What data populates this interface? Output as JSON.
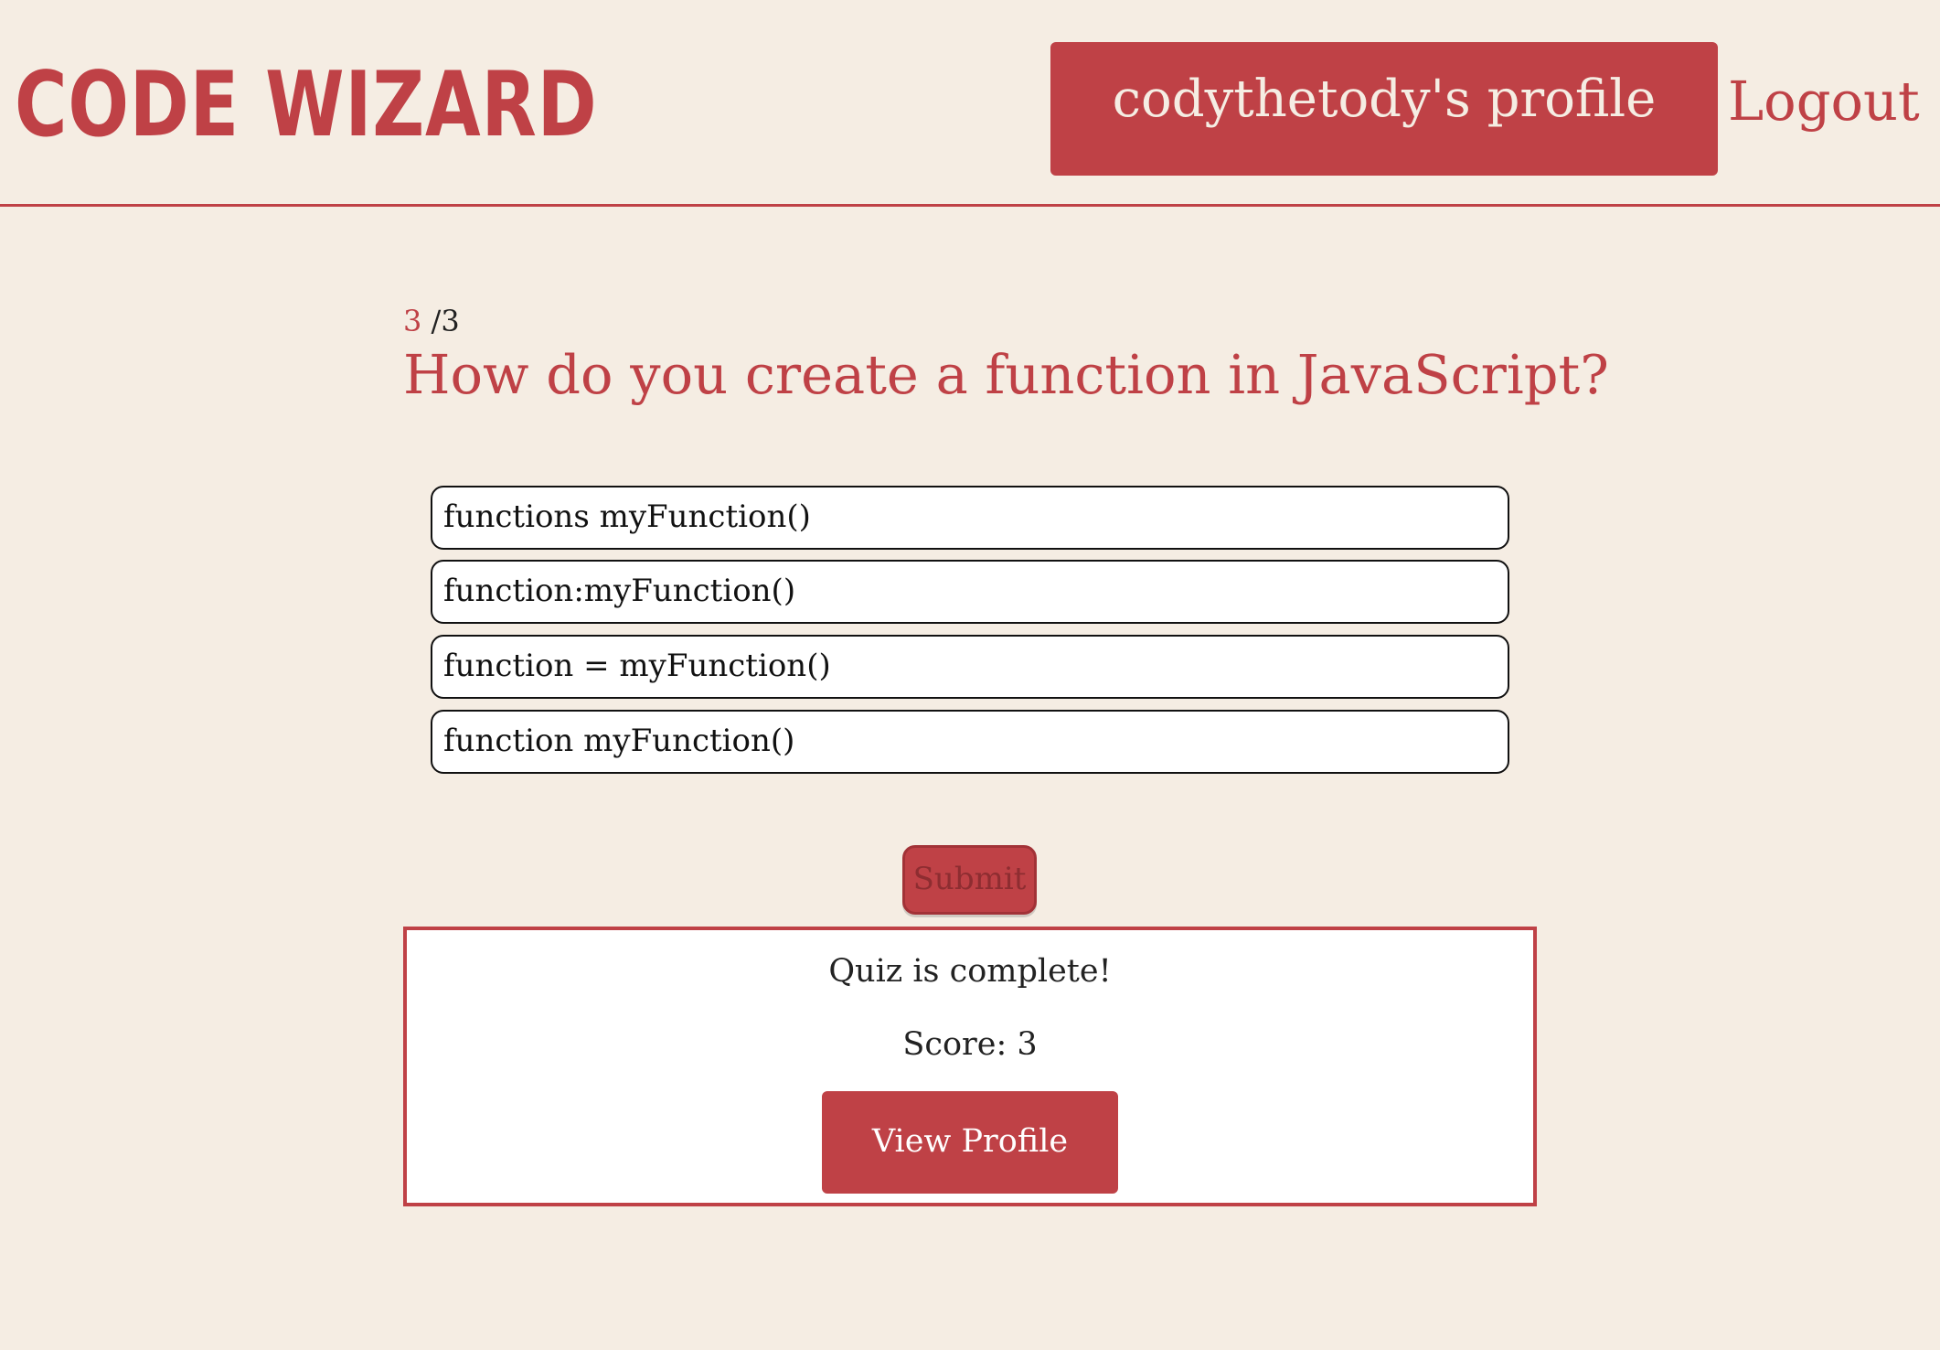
{
  "header": {
    "logo": "CODE WIZARD",
    "profile_button": "codythetody's profile",
    "logout_link": "Logout"
  },
  "quiz": {
    "current_question": "3",
    "total_separator": "/3",
    "question": "How do you create a function in JavaScript?",
    "answers": [
      "functions myFunction()",
      "function:myFunction()",
      "function = myFunction()",
      "function myFunction()"
    ],
    "submit_label": "Submit"
  },
  "result": {
    "message": "Quiz is complete!",
    "score": "Score: 3",
    "view_profile_label": "View Profile"
  },
  "colors": {
    "accent": "#bf4146",
    "background": "#f5ede3"
  }
}
